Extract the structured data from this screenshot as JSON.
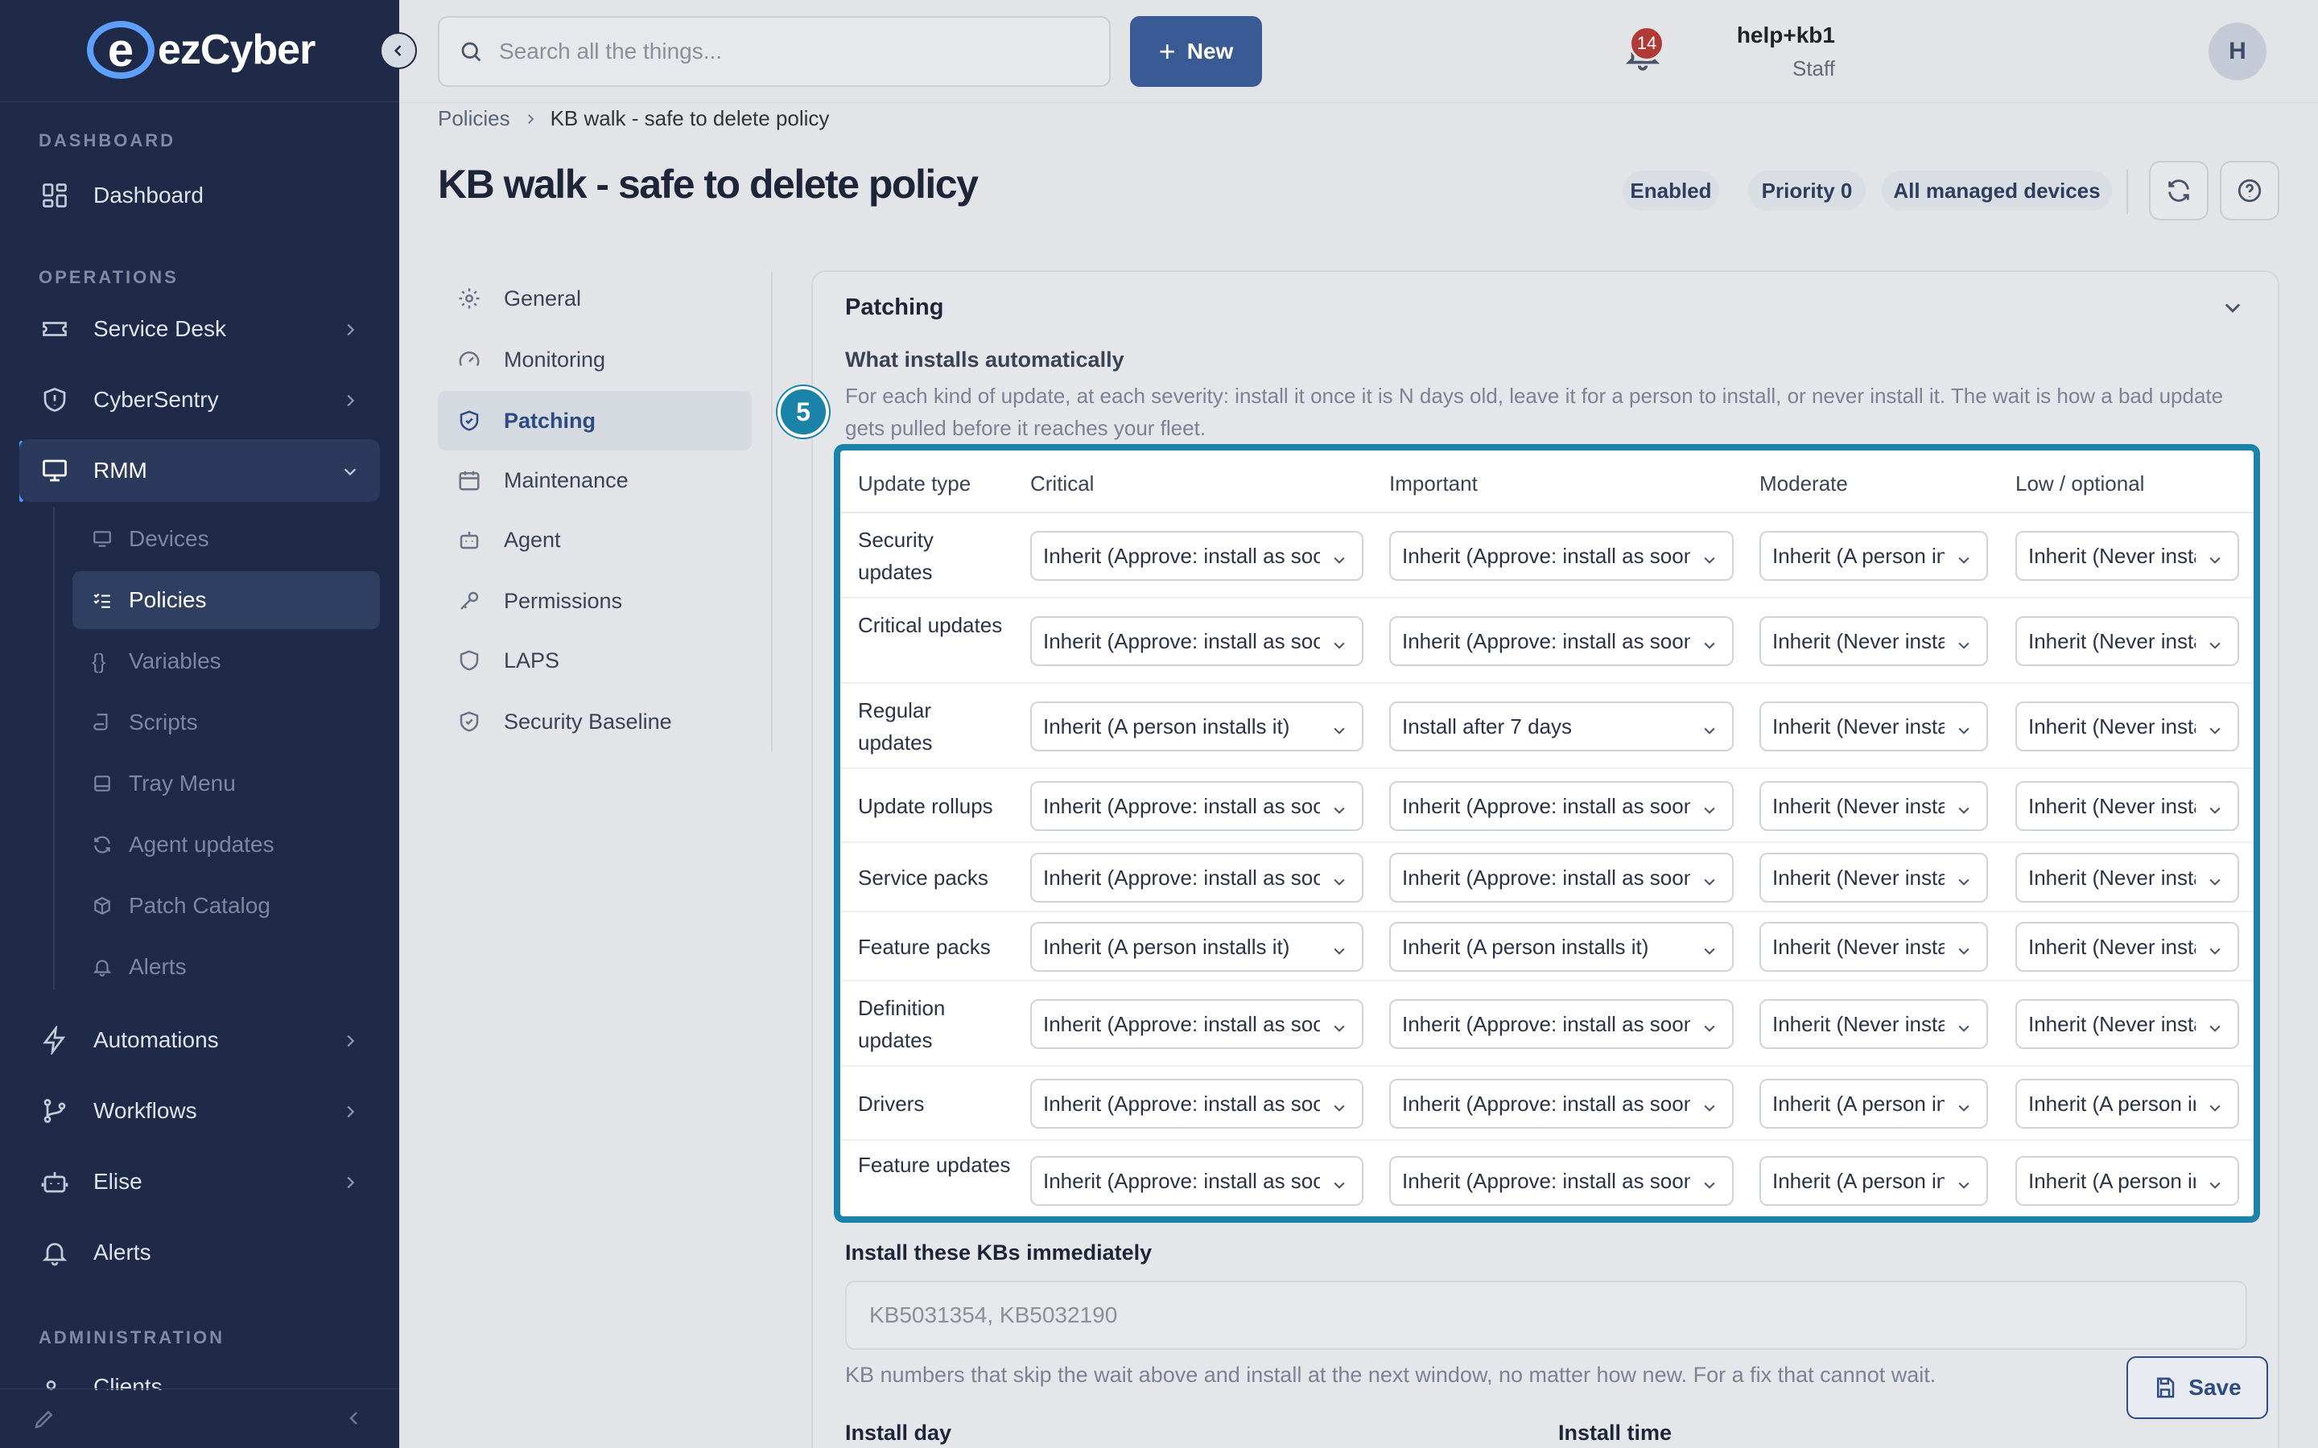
{
  "brand": {
    "logo_mark": "e",
    "logo_text": "ezCyber"
  },
  "sidebar": {
    "sections": {
      "dashboard": "DASHBOARD",
      "operations": "OPERATIONS",
      "administration": "ADMINISTRATION"
    },
    "items": {
      "dashboard": "Dashboard",
      "service_desk": "Service Desk",
      "cybersentry": "CyberSentry",
      "rmm": "RMM",
      "automations": "Automations",
      "workflows": "Workflows",
      "elise": "Elise",
      "alerts": "Alerts",
      "clients": "Clients"
    },
    "rmm_sub": {
      "devices": "Devices",
      "policies": "Policies",
      "variables": "Variables",
      "scripts": "Scripts",
      "tray_menu": "Tray Menu",
      "agent_updates": "Agent updates",
      "patch_catalog": "Patch Catalog",
      "alerts": "Alerts"
    }
  },
  "topbar": {
    "search_placeholder": "Search all the things...",
    "new_label": "New",
    "notif_count": "14",
    "user_name": "help+kb1",
    "user_role": "Staff",
    "avatar_initial": "H"
  },
  "breadcrumb": {
    "parent": "Policies",
    "current": "KB walk - safe to delete policy"
  },
  "header": {
    "title": "KB walk - safe to delete policy",
    "status": "Enabled",
    "priority": "Priority 0",
    "scope": "All managed devices"
  },
  "settings_nav": {
    "general": "General",
    "monitoring": "Monitoring",
    "patching": "Patching",
    "maintenance": "Maintenance",
    "agent": "Agent",
    "permissions": "Permissions",
    "laps": "LAPS",
    "security_baseline": "Security Baseline"
  },
  "patching": {
    "title": "Patching",
    "subtitle": "What installs automatically",
    "description": "For each kind of update, at each severity: install it once it is N days old, leave it for a person to install, or never install it. The wait is how a bad update gets pulled before it reaches your fleet.",
    "step_number": "5",
    "table": {
      "headers": [
        "Update type",
        "Critical",
        "Important",
        "Moderate",
        "Low / optional"
      ],
      "rows": [
        {
          "type": "Security updates",
          "critical": "Inherit (Approve: install as soon as released)",
          "important": "Inherit (Approve: install as soon as released)",
          "moderate": "Inherit (A person installs it)",
          "low": "Inherit (Never install)"
        },
        {
          "type": "Critical updates",
          "critical": "Inherit (Approve: install as soon as released)",
          "important": "Inherit (Approve: install as soon as released)",
          "moderate": "Inherit (Never install)",
          "low": "Inherit (Never install)"
        },
        {
          "type": "Regular updates",
          "critical": "Inherit (A person installs it)",
          "important": "Install after 7 days",
          "moderate": "Inherit (Never install)",
          "low": "Inherit (Never install)"
        },
        {
          "type": "Update rollups",
          "critical": "Inherit (Approve: install as soon as released)",
          "important": "Inherit (Approve: install as soon as released)",
          "moderate": "Inherit (Never install)",
          "low": "Inherit (Never install)"
        },
        {
          "type": "Service packs",
          "critical": "Inherit (Approve: install as soon as released)",
          "important": "Inherit (Approve: install as soon as released)",
          "moderate": "Inherit (Never install)",
          "low": "Inherit (Never install)"
        },
        {
          "type": "Feature packs",
          "critical": "Inherit (A person installs it)",
          "important": "Inherit (A person installs it)",
          "moderate": "Inherit (Never install)",
          "low": "Inherit (Never install)"
        },
        {
          "type": "Definition updates",
          "critical": "Inherit (Approve: install as soon as released)",
          "important": "Inherit (Approve: install as soon as released)",
          "moderate": "Inherit (Never install)",
          "low": "Inherit (Never install)"
        },
        {
          "type": "Drivers",
          "critical": "Inherit (Approve: install as soon as released)",
          "important": "Inherit (Approve: install as soon as released)",
          "moderate": "Inherit (A person installs it)",
          "low": "Inherit (A person installs it)"
        },
        {
          "type": "Feature updates",
          "critical": "Inherit (Approve: install as soon as released)",
          "important": "Inherit (Approve: install as soon as released)",
          "moderate": "Inherit (A person installs it)",
          "low": "Inherit (A person installs it)"
        }
      ]
    },
    "kb_label": "Install these KBs immediately",
    "kb_placeholder": "KB5031354, KB5032190",
    "kb_help": "KB numbers that skip the wait above and install at the next window, no matter how new. For a fix that cannot wait.",
    "install_day_label": "Install day",
    "install_time_label": "Install time"
  },
  "footer": {
    "save_label": "Save"
  },
  "colors": {
    "sidebar": "#1e2a47",
    "accent": "#3a5a96",
    "highlight": "#1c83a8",
    "badge": "#b03a36"
  }
}
